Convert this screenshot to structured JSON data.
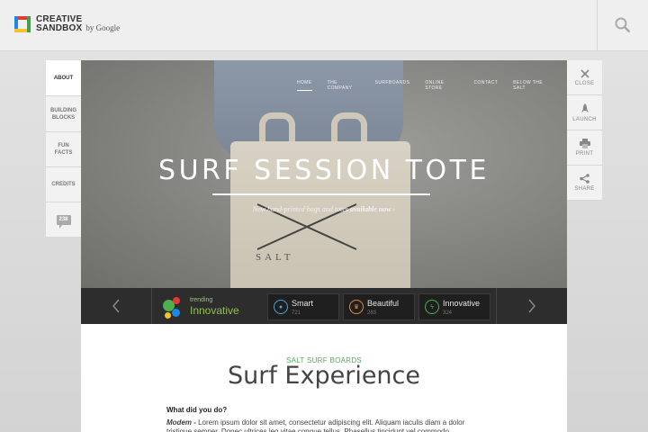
{
  "header": {
    "logo_line1": "CREATIVE",
    "logo_line2": "SANDBOX",
    "logo_by": "by Google",
    "search_icon": "search-icon"
  },
  "left_nav": {
    "items": [
      {
        "label": "ABOUT",
        "active": true
      },
      {
        "label": "BUILDING BLOCKS"
      },
      {
        "label": "FUN FACTS"
      },
      {
        "label": "CREDITS"
      }
    ],
    "comments_count": "238"
  },
  "right_nav": {
    "items": [
      {
        "label": "CLOSE",
        "icon": "close-icon"
      },
      {
        "label": "LAUNCH",
        "icon": "rocket-icon"
      },
      {
        "label": "PRINT",
        "icon": "print-icon"
      },
      {
        "label": "SHARE",
        "icon": "share-icon"
      }
    ]
  },
  "hero": {
    "nav": [
      "HOME",
      "THE COMPANY",
      "SURFBOARDS",
      "ONLINE STORE",
      "CONTACT",
      "BELOW THE SALT"
    ],
    "title": "SURF SESSION TOTE",
    "subtitle_plain": "New hand-printed bags and totes ",
    "subtitle_bold": "available now ›",
    "tote_brand": "SALT"
  },
  "trending": {
    "label": "trending",
    "value": "Innovative",
    "tags": [
      {
        "name": "Smart",
        "count": "721",
        "icon": "lightbulb-icon",
        "color": "#4aa3df"
      },
      {
        "name": "Beautiful",
        "count": "263",
        "icon": "crown-icon",
        "color": "#e08a3c"
      },
      {
        "name": "Innovative",
        "count": "324",
        "icon": "lightning-icon",
        "color": "#4caf50"
      }
    ]
  },
  "article": {
    "kicker": "SALT SURF BOARDS",
    "headline": "Surf Experience",
    "question": "What did you do?",
    "body_lead": "Modem - ",
    "body_text": "Lorem ipsum dolor sit amet, consectetur adipiscing elit. Aliquam iaculis diam a dolor",
    "body_cut": "tristique semper. Donec ultrices leo vitae congue tellus. Phasellus tincidunt vel commodo"
  },
  "colors": {
    "accent_green": "#4caf50",
    "strip_bg": "#2d2d2d"
  }
}
